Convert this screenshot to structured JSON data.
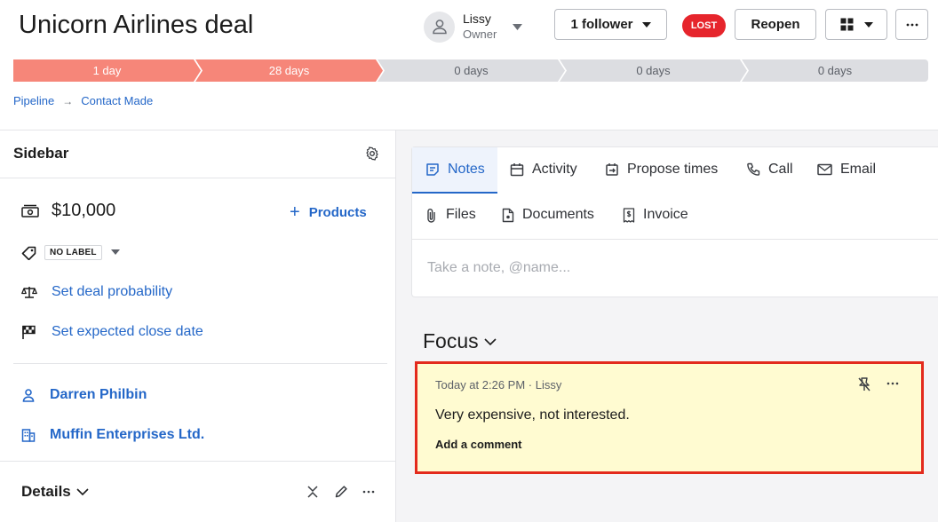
{
  "deal": {
    "title": "Unicorn Airlines deal",
    "owner_name": "Lissy",
    "owner_role": "Owner",
    "follower_label": "1 follower",
    "status_badge": "LOST",
    "reopen_label": "Reopen"
  },
  "stages": [
    {
      "label": "1 day",
      "state": "done"
    },
    {
      "label": "28 days",
      "state": "done"
    },
    {
      "label": "0 days",
      "state": "todo"
    },
    {
      "label": "0 days",
      "state": "todo"
    },
    {
      "label": "0 days",
      "state": "todo"
    }
  ],
  "breadcrumb": {
    "pipeline": "Pipeline",
    "arrow": "→",
    "stage": "Contact Made"
  },
  "sidebar": {
    "title": "Sidebar",
    "amount": "$10,000",
    "products_label": "Products",
    "products_plus": "+",
    "label_tag": "NO LABEL",
    "probability": "Set deal probability",
    "close_date": "Set expected close date",
    "person": "Darren Philbin",
    "organization": "Muffin Enterprises Ltd.",
    "details_label": "Details"
  },
  "tabs": [
    {
      "label": "Notes",
      "icon": "note-icon",
      "active": true
    },
    {
      "label": "Activity",
      "icon": "calendar-icon"
    },
    {
      "label": "Propose times",
      "icon": "propose-times-icon"
    },
    {
      "label": "Call",
      "icon": "phone-icon"
    },
    {
      "label": "Email",
      "icon": "envelope-icon"
    },
    {
      "label": "Files",
      "icon": "paperclip-icon"
    },
    {
      "label": "Documents",
      "icon": "document-icon"
    },
    {
      "label": "Invoice",
      "icon": "invoice-icon"
    }
  ],
  "composer": {
    "placeholder": "Take a note, @name..."
  },
  "focus": {
    "title": "Focus",
    "note": {
      "meta": "Today at 2:26 PM · Lissy",
      "text": "Very expensive, not interested.",
      "comment_label": "Add a comment"
    }
  },
  "colors": {
    "accent": "#2467c8",
    "stage_done": "#f68679",
    "stage_todo": "#dcdde1",
    "lost": "#e6252c",
    "note_bg": "#fffbd1",
    "highlight_border": "#e32a1d"
  }
}
